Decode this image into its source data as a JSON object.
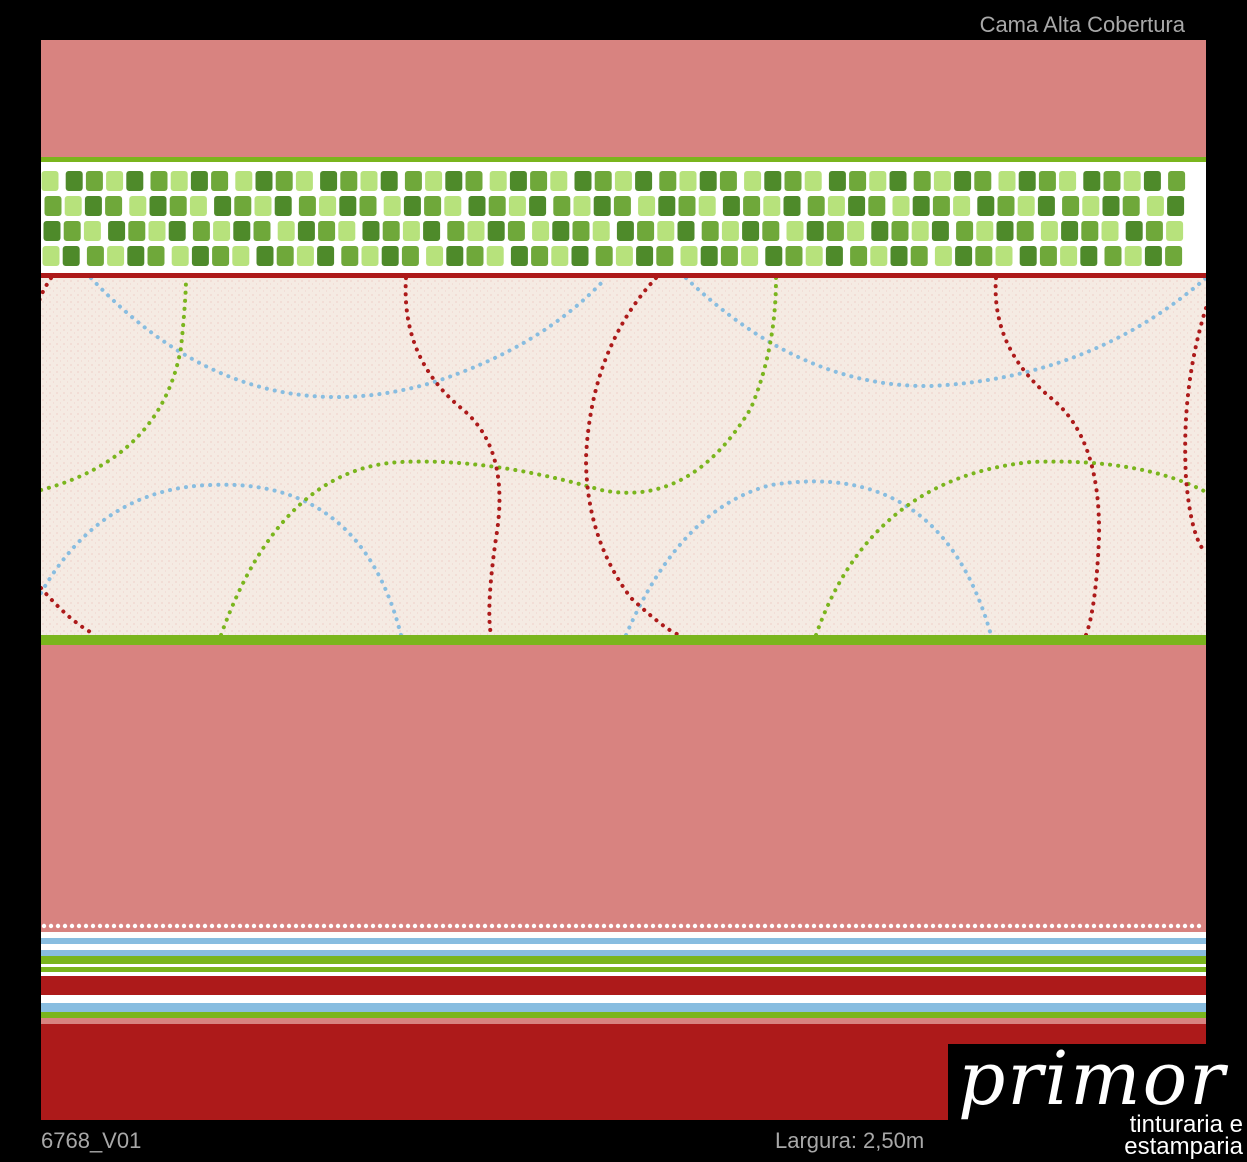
{
  "header": {
    "title": "Cama Alta Cobertura"
  },
  "footer": {
    "code": "6768_V01",
    "width_label": "Largura: 2,50m"
  },
  "logo": {
    "word": "primor",
    "line1": "tinturaria e",
    "line2": "estamparia"
  },
  "colors": {
    "background": "#000000",
    "salmon": "#d88380",
    "green": "#7ab51d",
    "light_green": "#b7e27c",
    "dark_green": "#4e8a2a",
    "cream": "#f5ebe3",
    "red": "#ad1a1a",
    "blue": "#88bde0",
    "white": "#ffffff"
  }
}
